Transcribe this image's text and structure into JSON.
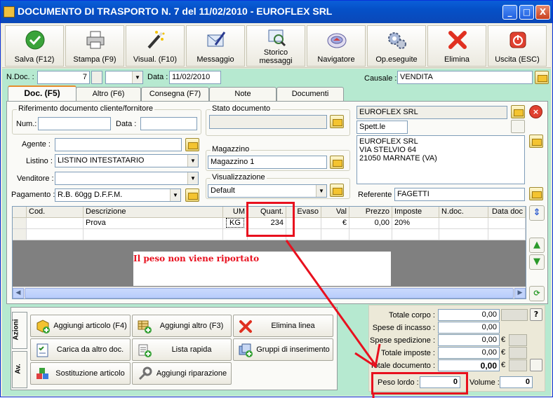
{
  "window": {
    "title": "DOCUMENTO DI TRASPORTO N. 7  del 11/02/2010 - EUROFLEX  SRL",
    "controls": [
      "_",
      "□",
      "X"
    ]
  },
  "toolbar": [
    {
      "key": "save",
      "label": "Salva (F12)",
      "icon": "check-icon"
    },
    {
      "key": "print",
      "label": "Stampa (F9)",
      "icon": "printer-icon"
    },
    {
      "key": "visual",
      "label": "Visual. (F10)",
      "icon": "magic-wand-icon"
    },
    {
      "key": "message",
      "label": "Messaggio",
      "icon": "message-pen-icon"
    },
    {
      "key": "history",
      "label_1": "Storico",
      "label_2": "messaggi",
      "icon": "history-magnifier-icon"
    },
    {
      "key": "navigator",
      "label": "Navigatore",
      "icon": "compass-icon"
    },
    {
      "key": "done",
      "label": "Op.eseguite",
      "icon": "gears-icon"
    },
    {
      "key": "delete",
      "label": "Elimina",
      "icon": "red-x-icon"
    },
    {
      "key": "exit",
      "label": "Uscita (ESC)",
      "icon": "power-icon"
    }
  ],
  "header": {
    "ndoc_label": "N.Doc. :",
    "ndoc_value": "7",
    "data_label": "Data :",
    "data_value": "11/02/2010",
    "causale_label": "Causale :",
    "causale_value": "VENDITA"
  },
  "tabs": [
    "Doc. (F5)",
    "Altro (F6)",
    "Consegna (F7)",
    "Note",
    "Documenti"
  ],
  "form": {
    "rif_title": "Riferimento documento cliente/fornitore",
    "num_label": "Num.:",
    "data_label": "Data :",
    "stato_title": "Stato documento",
    "agente_label": "Agente :",
    "listino_label": "Listino :",
    "listino_value": "LISTINO INTESTATARIO",
    "venditore_label": "Venditore :",
    "pagamento_label": "Pagamento :",
    "pagamento_value": "R.B. 60gg D.F.F.M.",
    "magazzino_title": "Magazzino",
    "magazzino_value": "Magazzino 1",
    "visualizzazione_title": "Visualizzazione",
    "visualizzazione_value": "Default"
  },
  "customer": {
    "name": "EUROFLEX  SRL",
    "salutation": "Spett.le",
    "address": [
      "EUROFLEX  SRL",
      "VIA STELVIO 64",
      "21050 MARNATE (VA)"
    ],
    "referente_label": "Referente",
    "referente_value": "FAGETTI"
  },
  "grid": {
    "columns": [
      "Cod.",
      "Descrizione",
      "UM",
      "Quant.",
      "Evaso",
      "Val",
      "Prezzo",
      "Imposte",
      "N.doc.",
      "Data doc"
    ],
    "rows": [
      [
        "",
        "Prova",
        "KG",
        "234",
        "",
        "€",
        "0,00",
        "20%",
        "",
        ""
      ]
    ]
  },
  "annotation": "Il peso non viene riportato",
  "actions": {
    "vtabs": [
      "Azioni",
      "Av."
    ],
    "buttons": [
      [
        "Aggiungi articolo (F4)",
        "Aggiungi altro (F3)",
        "Elimina linea"
      ],
      [
        "Carica da altro doc.",
        "Lista rapida",
        "Gruppi di inserimento"
      ],
      [
        "Sostituzione articolo",
        "Aggiungi riparazione"
      ]
    ]
  },
  "totals": {
    "rows": [
      {
        "label": "Totale corpo :",
        "value": "0,00",
        "unit": ""
      },
      {
        "label": "Spese di incasso :",
        "value": "0,00",
        "unit": ""
      },
      {
        "label": "Spese spedizione :",
        "value": "0,00",
        "unit": "€"
      },
      {
        "label": "Totale imposte :",
        "value": "0,00",
        "unit": "€"
      },
      {
        "label": "Totale documento :",
        "value": "0,00",
        "unit": "€"
      }
    ],
    "help_label": "?",
    "peso_label": "Peso lordo :",
    "peso_value": "0",
    "volume_label": "Volume :",
    "volume_value": "0"
  },
  "colors": {
    "highlight": "#e8101e",
    "panel_green": "#b6e9d0",
    "title_blue": "#0550c7"
  }
}
